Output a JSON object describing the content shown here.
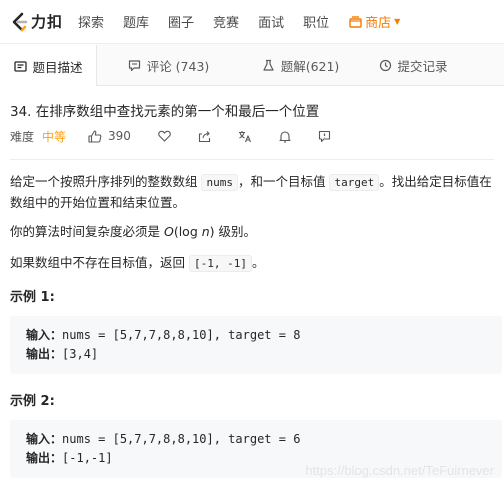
{
  "nav": {
    "logo_text": "力扣",
    "items": [
      "探索",
      "题库",
      "圈子",
      "竞赛",
      "面试",
      "职位"
    ],
    "store_label": "商店",
    "accent": "#f57c00"
  },
  "tabs": [
    {
      "label": "题目描述",
      "icon": "document-icon"
    },
    {
      "label": "评论 (743)",
      "icon": "comment-icon"
    },
    {
      "label": "题解(621)",
      "icon": "flask-icon"
    },
    {
      "label": "提交记录",
      "icon": "clock-icon"
    }
  ],
  "problem": {
    "title": "34. 在排序数组中查找元素的第一个和最后一个位置",
    "difficulty_label": "难度",
    "difficulty": "中等",
    "difficulty_color": "#ffa116",
    "likes": "390",
    "desc_p1_a": "给定一个按照升序排列的整数数组 ",
    "desc_p1_code1": "nums",
    "desc_p1_b": "，和一个目标值 ",
    "desc_p1_code2": "target",
    "desc_p1_c": "。找出给定目标值在数组中的开始位置和结束位置。",
    "desc_p2_a": "你的算法时间复杂度必须是 ",
    "desc_p2_b": "O",
    "desc_p2_c": "(log ",
    "desc_p2_d": "n",
    "desc_p2_e": ") 级别。",
    "desc_p3_a": "如果数组中不存在目标值，返回 ",
    "desc_p3_code": "[-1, -1]",
    "desc_p3_b": "。"
  },
  "examples": [
    {
      "title": "示例 1:",
      "input_label": "输入：",
      "input": "nums = [5,7,7,8,8,10], target = 8",
      "output_label": "输出：",
      "output": "[3,4]"
    },
    {
      "title": "示例 2:",
      "input_label": "输入：",
      "input": "nums = [5,7,7,8,8,10], target = 6",
      "output_label": "输出：",
      "output": "[-1,-1]"
    }
  ],
  "watermark": "https://blog.csdn.net/TeFuirnever"
}
